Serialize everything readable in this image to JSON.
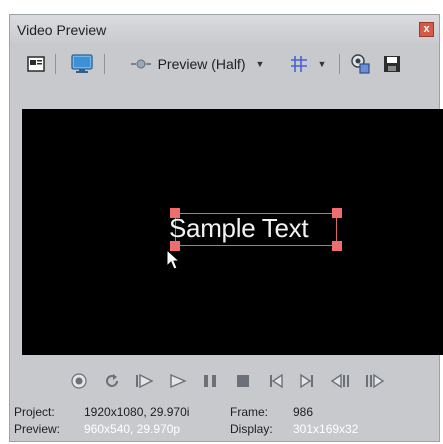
{
  "window": {
    "title": "Video Preview",
    "close_glyph": "x"
  },
  "toolbar": {
    "preview_label": "Preview (Half)",
    "icons": [
      "properties-icon",
      "monitor-icon",
      "preview-quality-icon",
      "overlays-grid-icon",
      "copy-snapshot-icon",
      "save-snapshot-icon"
    ]
  },
  "canvas": {
    "sample_text": "Sample Text",
    "selection_color": "#e06666",
    "background": "#000000"
  },
  "transport": {
    "buttons": [
      "record",
      "loop",
      "play-from-start",
      "play",
      "pause",
      "stop",
      "previous-frame-marker",
      "next-frame-marker",
      "previous-frame",
      "next-frame"
    ]
  },
  "status": {
    "project_label": "Project:",
    "project_value": "1920x1080, 29.970i",
    "frame_label": "Frame:",
    "frame_value": "986",
    "preview_label": "Preview:",
    "preview_value": "960x540, 29.970p",
    "display_label": "Display:",
    "display_value": "301x169x32"
  }
}
